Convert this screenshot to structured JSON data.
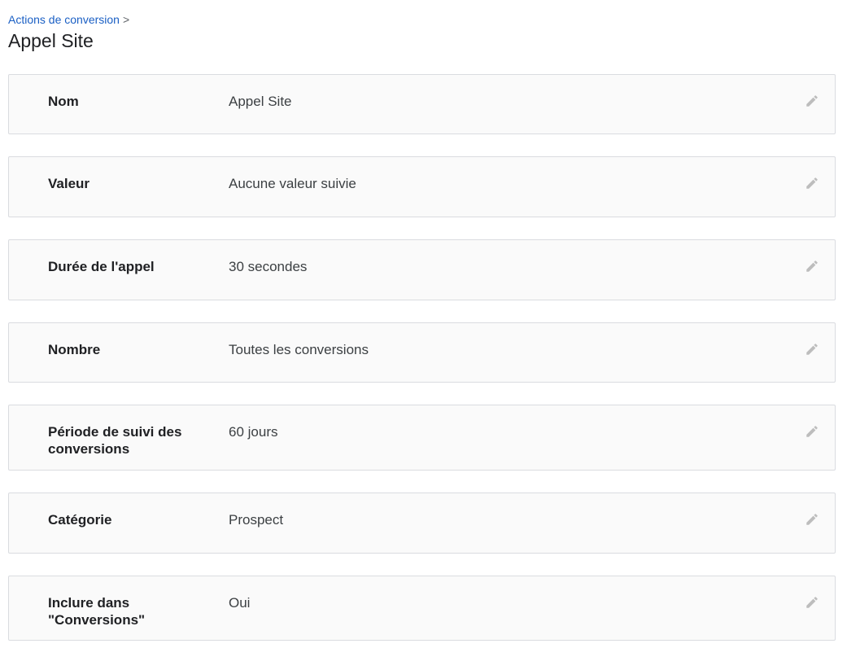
{
  "breadcrumb": {
    "link_label": "Actions de conversion",
    "separator": ">"
  },
  "page": {
    "title": "Appel Site"
  },
  "settings": [
    {
      "label": "Nom",
      "value": "Appel Site"
    },
    {
      "label": "Valeur",
      "value": "Aucune valeur suivie"
    },
    {
      "label": "Durée de l'appel",
      "value": "30 secondes"
    },
    {
      "label": "Nombre",
      "value": "Toutes les conversions"
    },
    {
      "label": "Période de suivi des conversions",
      "value": "60 jours"
    },
    {
      "label": "Catégorie",
      "value": "Prospect"
    },
    {
      "label": "Inclure dans \"Conversions\"",
      "value": "Oui"
    }
  ],
  "icons": {
    "edit": "pencil-icon"
  },
  "colors": {
    "link": "#1a5fc4",
    "card_background": "#fafafa",
    "card_border": "#dadce0",
    "icon": "#bdbdbd"
  }
}
